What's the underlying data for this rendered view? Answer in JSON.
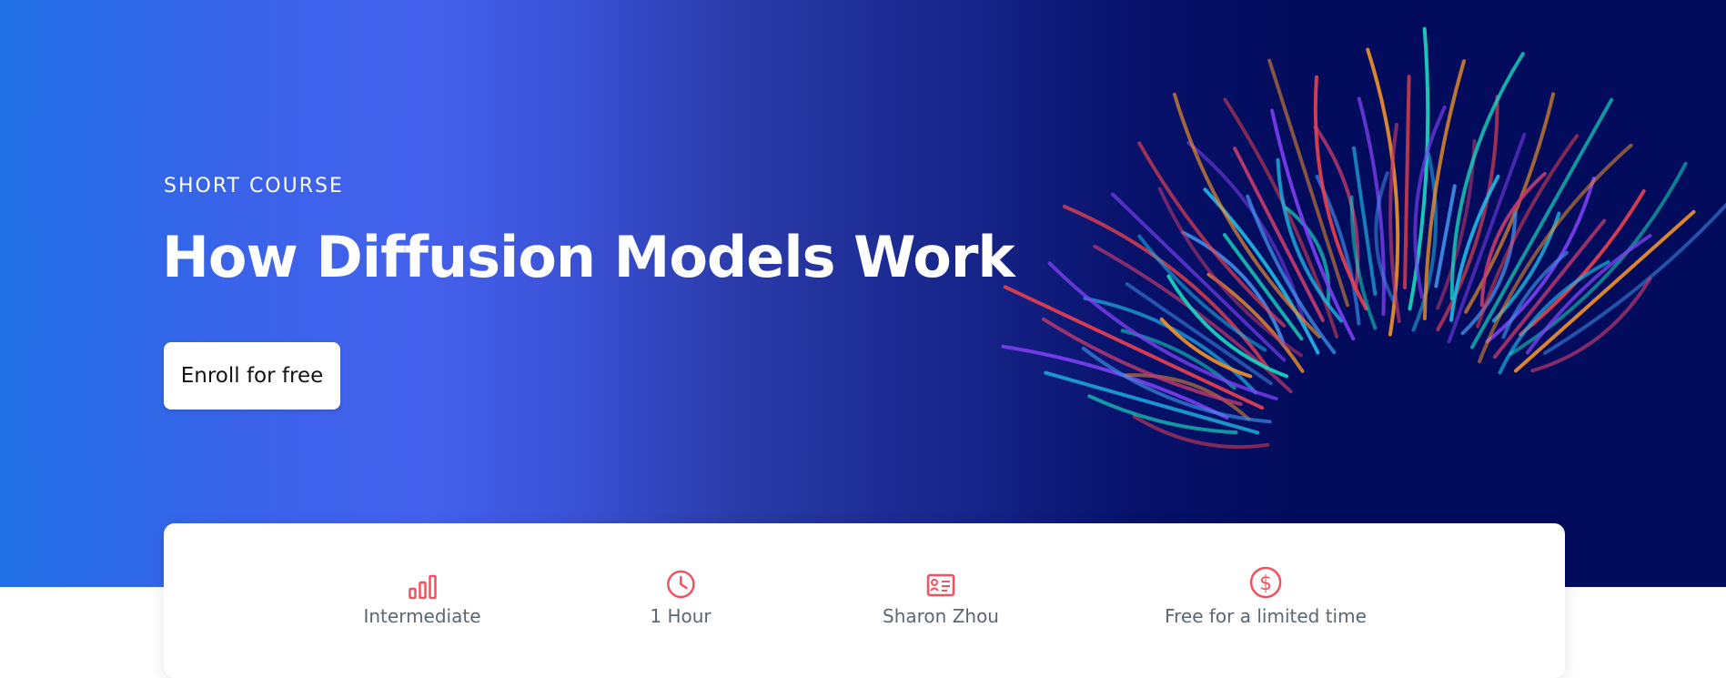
{
  "hero": {
    "eyebrow": "SHORT COURSE",
    "title": "How Diffusion Models Work",
    "cta_label": "Enroll for free"
  },
  "info": {
    "items": [
      {
        "icon": "bar-chart-icon",
        "label": "Intermediate"
      },
      {
        "icon": "clock-icon",
        "label": "1 Hour"
      },
      {
        "icon": "instructor-icon",
        "label": "Sharon Zhou"
      },
      {
        "icon": "dollar-icon",
        "label": "Free for a limited time"
      }
    ]
  },
  "colors": {
    "hero_left": "#2170e6",
    "hero_mid": "#4461ec",
    "hero_right": "#030c5c",
    "icon_accent": "#f0525f",
    "info_text": "#5b6673"
  }
}
